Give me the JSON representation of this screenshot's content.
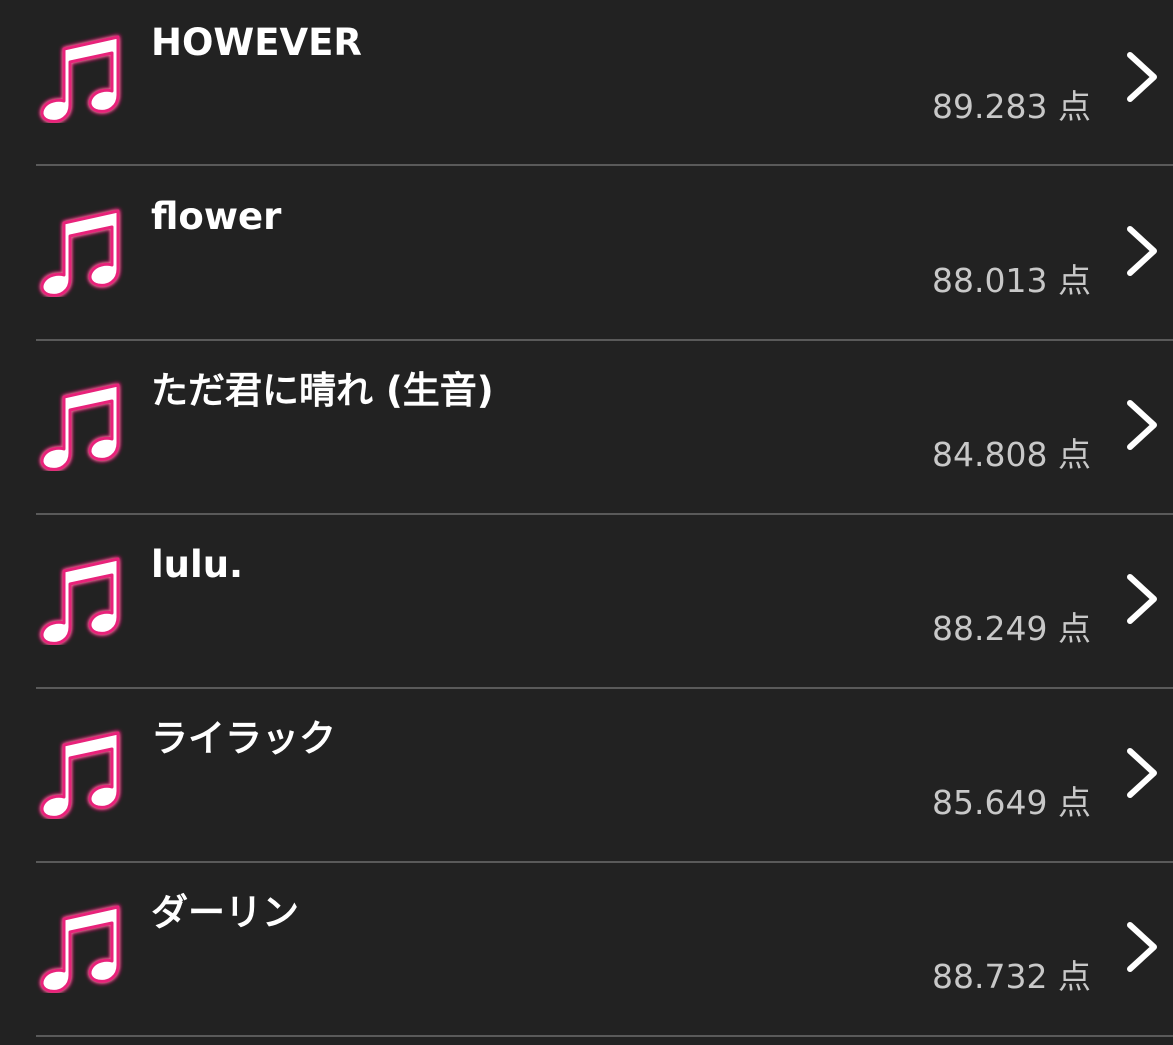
{
  "colors": {
    "background": "#222222",
    "title": "#ffffff",
    "score": "#c8c8c8",
    "separator": "#5a5a5a",
    "icon_glow": "#e8207a",
    "icon_fill": "#ffffff"
  },
  "icons": {
    "row_icon": "music-note-icon",
    "disclosure": "chevron-right-icon"
  },
  "songs": [
    {
      "title": "HOWEVER",
      "score": "89.283 点"
    },
    {
      "title": "flower",
      "score": "88.013 点"
    },
    {
      "title": "ただ君に晴れ (生音)",
      "score": "84.808 点"
    },
    {
      "title": "lulu.",
      "score": "88.249 点"
    },
    {
      "title": "ライラック",
      "score": "85.649 点"
    },
    {
      "title": "ダーリン",
      "score": "88.732 点"
    }
  ]
}
